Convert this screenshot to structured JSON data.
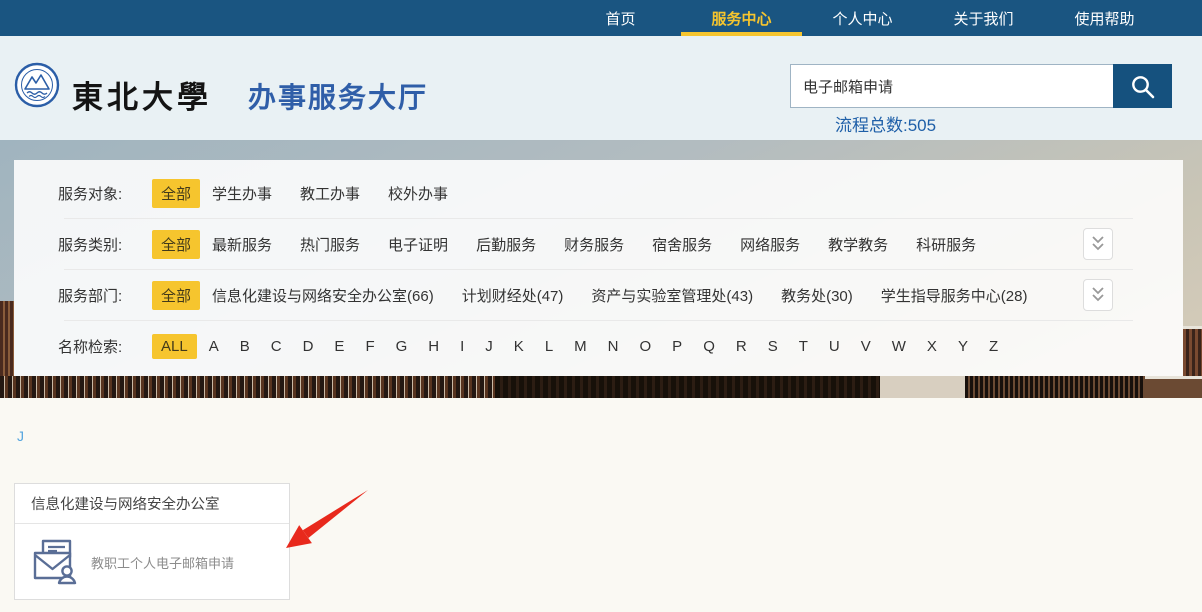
{
  "nav": {
    "items": [
      {
        "label": "首页",
        "active": false
      },
      {
        "label": "服务中心",
        "active": true
      },
      {
        "label": "个人中心",
        "active": false
      },
      {
        "label": "关于我们",
        "active": false
      },
      {
        "label": "使用帮助",
        "active": false
      }
    ]
  },
  "header": {
    "university_name": "東北大學",
    "site_title": "办事服务大厅",
    "search": {
      "value": "电子邮箱申请",
      "button_icon": "search-icon"
    },
    "process_total": "流程总数:505"
  },
  "filters": {
    "rows": [
      {
        "label": "服务对象:",
        "all": "全部",
        "expand": false,
        "items": [
          "学生办事",
          "教工办事",
          "校外办事"
        ]
      },
      {
        "label": "服务类别:",
        "all": "全部",
        "expand": true,
        "items": [
          "最新服务",
          "热门服务",
          "电子证明",
          "后勤服务",
          "财务服务",
          "宿舍服务",
          "网络服务",
          "教学教务",
          "科研服务"
        ]
      },
      {
        "label": "服务部门:",
        "all": "全部",
        "expand": true,
        "items": [
          "信息化建设与网络安全办公室(66)",
          "计划财经处(47)",
          "资产与实验室管理处(43)",
          "教务处(30)",
          "学生指导服务中心(28)"
        ]
      },
      {
        "label": "名称检索:",
        "all": "ALL",
        "expand": false,
        "items": [
          "A",
          "B",
          "C",
          "D",
          "E",
          "F",
          "G",
          "H",
          "I",
          "J",
          "K",
          "L",
          "M",
          "N",
          "O",
          "P",
          "Q",
          "R",
          "S",
          "T",
          "U",
          "V",
          "W",
          "X",
          "Y",
          "Z"
        ]
      }
    ]
  },
  "results": {
    "letter_heading": "J",
    "card": {
      "department": "信息化建设与网络安全办公室",
      "service": "教职工个人电子邮箱申请",
      "icon": "email-user-icon"
    },
    "annotation": "red-arrow"
  },
  "colors": {
    "nav_bg": "#1a5581",
    "accent_gold": "#f6c52e",
    "title_blue": "#2f5ea8",
    "count_blue": "#1e5fa8",
    "search_btn": "#15517e",
    "arrow_red": "#e8291c",
    "icon_slate": "#5a6e96",
    "letter_link": "#55a5de"
  }
}
